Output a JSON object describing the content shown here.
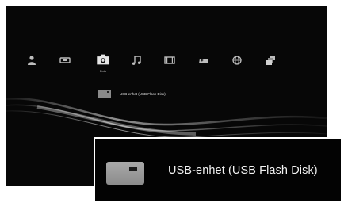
{
  "xmb": {
    "categories": [
      {
        "icon": "users-icon"
      },
      {
        "icon": "settings-icon"
      },
      {
        "icon": "photo-camera-icon",
        "label": "Foto"
      },
      {
        "icon": "music-note-icon"
      },
      {
        "icon": "video-icon"
      },
      {
        "icon": "game-controller-icon"
      },
      {
        "icon": "network-globe-icon"
      },
      {
        "icon": "playstation-network-icon"
      }
    ],
    "selected_item": {
      "icon": "usb-drive-icon",
      "label": "USB-enhet (USB Flash Disk)"
    }
  },
  "zoom_callout": {
    "icon": "usb-drive-icon",
    "label": "USB-enhet (USB Flash Disk)"
  }
}
